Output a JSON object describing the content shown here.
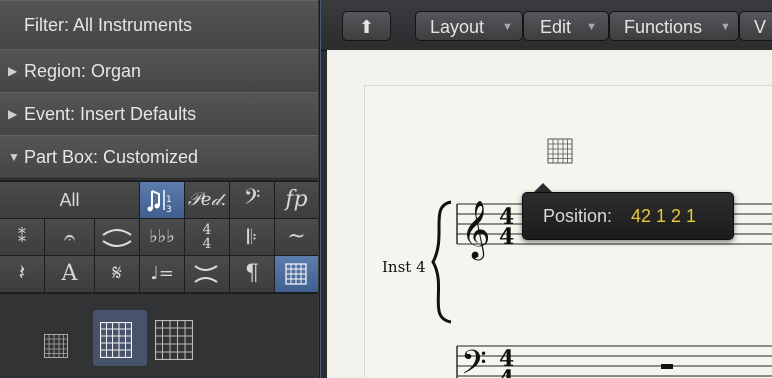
{
  "inspector": {
    "filter_label": "Filter: All Instruments",
    "region_label": "Region:  Organ",
    "event_label": "Event:  Insert Defaults",
    "partbox_label": "Part Box: Customized"
  },
  "partbox": {
    "all_label": "All",
    "symbols": {
      "pedal": "𝒫𝑒𝒹.",
      "dynamic": "fp",
      "time_sig": "4\n4",
      "text_A": "A",
      "pilcrow": "¶",
      "tempo": "♩="
    }
  },
  "toolbar": {
    "up_label": "⬆",
    "layout_label": "Layout",
    "edit_label": "Edit",
    "functions_label": "Functions",
    "view_label": "V"
  },
  "score": {
    "instrument_label": "Inst 4",
    "time_signature_top": "4",
    "time_signature_bottom": "4"
  },
  "tooltip": {
    "prefix": "Position:",
    "value": "42 1 2 1"
  },
  "colors": {
    "accent_selected": "#4f6f9f",
    "tooltip_value": "#e9c83c"
  }
}
